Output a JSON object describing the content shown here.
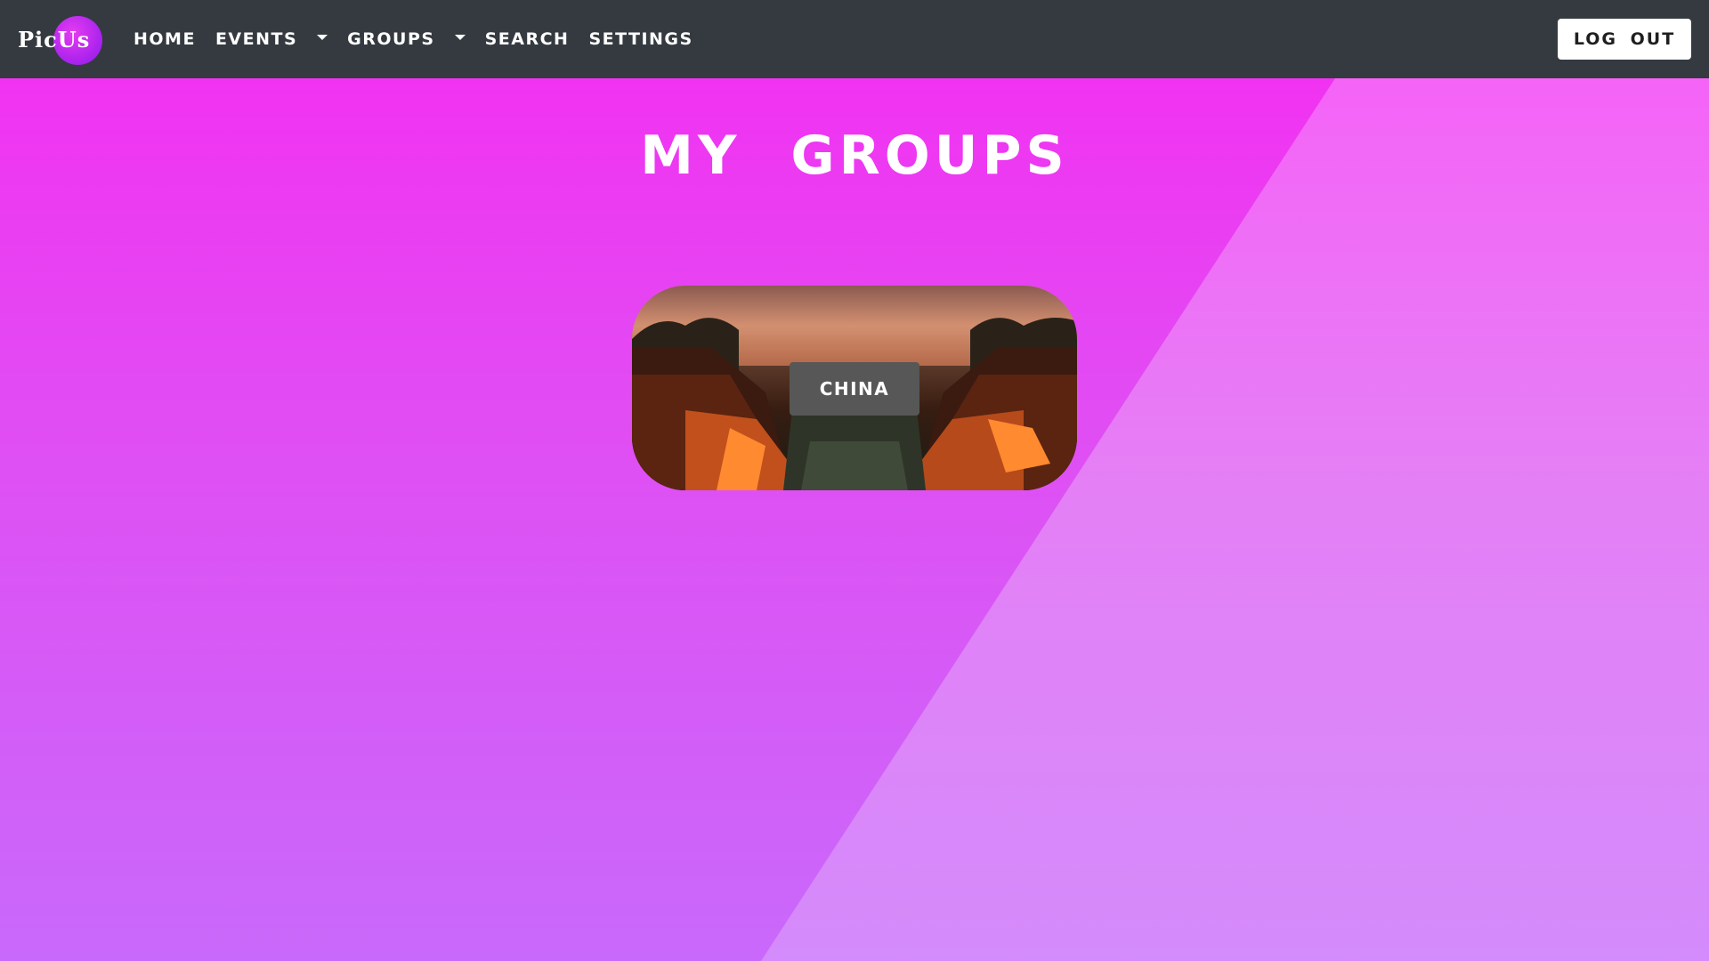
{
  "app": {
    "brand": "PicUs",
    "accent_color": "#f52cf2"
  },
  "nav": {
    "items": [
      {
        "label": "HOME",
        "dropdown": false
      },
      {
        "label": "EVENTS",
        "dropdown": true
      },
      {
        "label": "GROUPS",
        "dropdown": true
      },
      {
        "label": "SEARCH",
        "dropdown": false
      },
      {
        "label": "SETTINGS",
        "dropdown": false
      }
    ],
    "logout_label": "LOG OUT"
  },
  "main": {
    "title": "MY GROUPS",
    "groups": [
      {
        "name": "CHINA",
        "image": "old-town-rooftops-at-sunset"
      }
    ]
  }
}
